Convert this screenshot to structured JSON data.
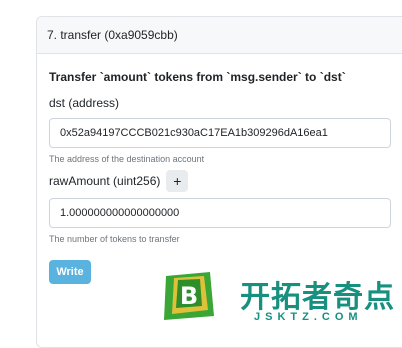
{
  "function": {
    "header": "7. transfer (0xa9059cbb)",
    "description": "Transfer `amount` tokens from `msg.sender` to `dst`",
    "params": [
      {
        "label": "dst (address)",
        "value": "0x52a94197CCCB021c930aC17EA1b309296dA16ea1",
        "help": "The address of the destination account"
      },
      {
        "label": "rawAmount (uint256)",
        "value": "1.000000000000000000",
        "help": "The number of tokens to transfer",
        "add_label": "+"
      }
    ],
    "write_label": "Write"
  },
  "watermark": {
    "cn": "开拓者奇点",
    "en": "JSKTZ.COM",
    "logo_letter": "B"
  },
  "colors": {
    "write_button": "#5ab2df",
    "watermark": "#17907f",
    "logo_green": "#3aa635"
  }
}
